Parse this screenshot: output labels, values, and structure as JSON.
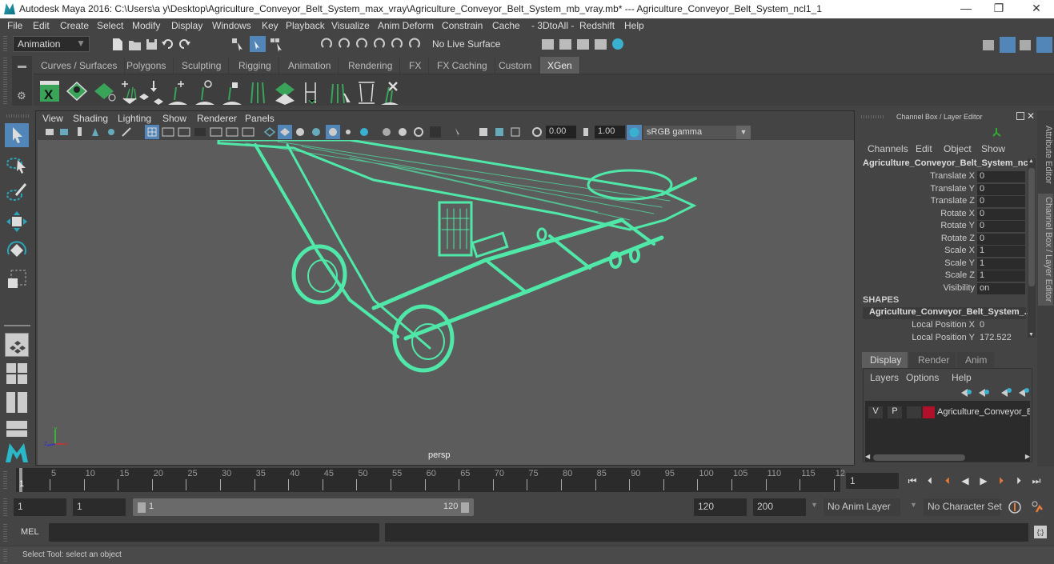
{
  "window": {
    "title": "Autodesk Maya 2016: C:\\Users\\a y\\Desktop\\Agriculture_Conveyor_Belt_System_max_vray\\Agriculture_Conveyor_Belt_System_mb_vray.mb*  ---  Agriculture_Conveyor_Belt_System_ncl1_1",
    "minimize": "—",
    "maximize": "❐",
    "close": "✕"
  },
  "menu": [
    "File",
    "Edit",
    "Create",
    "Select",
    "Modify",
    "Display",
    "Windows",
    "Key",
    "Playback",
    "Visualize",
    "Anim Deform",
    "Constrain",
    "Cache",
    "- 3DtoAll -",
    "Redshift",
    "Help"
  ],
  "toolbar": {
    "mode": "Animation",
    "live_surface": "No Live Surface"
  },
  "shelf_tabs": [
    "Curves / Surfaces",
    "Polygons",
    "Sculpting",
    "Rigging",
    "Animation",
    "Rendering",
    "FX",
    "FX Caching",
    "Custom",
    "XGen"
  ],
  "active_shelf_tab": "XGen",
  "shelf_icons": [
    "xgen-editor-icon",
    "xgen-preview-icon",
    "xgen-clear-preview-icon",
    "add-guide-icon",
    "move-guide-icon",
    "add-guide-plus-icon",
    "select-guide-icon",
    "lock-guide-icon",
    "guide-lines-icon",
    "create-patch-icon",
    "guide-tool-icon",
    "sculpt-guide-icon",
    "guide-frame-icon",
    "delete-guide-icon"
  ],
  "viewport": {
    "menu": [
      "View",
      "Shading",
      "Lighting",
      "Show",
      "Renderer",
      "Panels"
    ],
    "exposure": "0.00",
    "gamma": "1.00",
    "color_space": "sRGB gamma",
    "camera_label": "persp",
    "wire_color": "#4fe8a8",
    "axis_labels": {
      "x": "x",
      "y": "Y",
      "z": "Z"
    }
  },
  "channel_box": {
    "title": "Channel Box / Layer Editor",
    "menu": [
      "Channels",
      "Edit",
      "Object",
      "Show"
    ],
    "object_name": "Agriculture_Conveyor_Belt_System_nc...",
    "channels": [
      {
        "label": "Translate X",
        "value": "0"
      },
      {
        "label": "Translate Y",
        "value": "0"
      },
      {
        "label": "Translate Z",
        "value": "0"
      },
      {
        "label": "Rotate X",
        "value": "0"
      },
      {
        "label": "Rotate Y",
        "value": "0"
      },
      {
        "label": "Rotate Z",
        "value": "0"
      },
      {
        "label": "Scale X",
        "value": "1"
      },
      {
        "label": "Scale Y",
        "value": "1"
      },
      {
        "label": "Scale Z",
        "value": "1"
      },
      {
        "label": "Visibility",
        "value": "on"
      }
    ],
    "shapes_header": "SHAPES",
    "shape_name": "Agriculture_Conveyor_Belt_System_...",
    "shape_channels": [
      {
        "label": "Local Position X",
        "value": "0"
      },
      {
        "label": "Local Position Y",
        "value": "172.522"
      }
    ]
  },
  "side_tabs": [
    "Attribute Editor",
    "Channel Box / Layer Editor"
  ],
  "layer_editor": {
    "tabs": [
      "Display",
      "Render",
      "Anim"
    ],
    "active_tab": "Display",
    "menu": [
      "Layers",
      "Options",
      "Help"
    ],
    "layers": [
      {
        "v": "V",
        "p": "P",
        "color": "#b0102a",
        "name": "Agriculture_Conveyor_Be"
      }
    ]
  },
  "timeline": {
    "ticks": [
      "5",
      "10",
      "15",
      "20",
      "25",
      "30",
      "35",
      "40",
      "45",
      "50",
      "55",
      "60",
      "65",
      "70",
      "75",
      "80",
      "85",
      "90",
      "95",
      "100",
      "105",
      "110",
      "115",
      "12"
    ],
    "current_frame_marker": "1",
    "current_frame": "1"
  },
  "range": {
    "start": "1",
    "playback_start": "1",
    "slider_start": "1",
    "slider_end": "120",
    "playback_end": "120",
    "end": "200",
    "anim_layer": "No Anim Layer",
    "character_set": "No Character Set"
  },
  "command_line": {
    "label": "MEL",
    "input": "",
    "result": ""
  },
  "status": {
    "help_line": "Select Tool: select an object"
  }
}
